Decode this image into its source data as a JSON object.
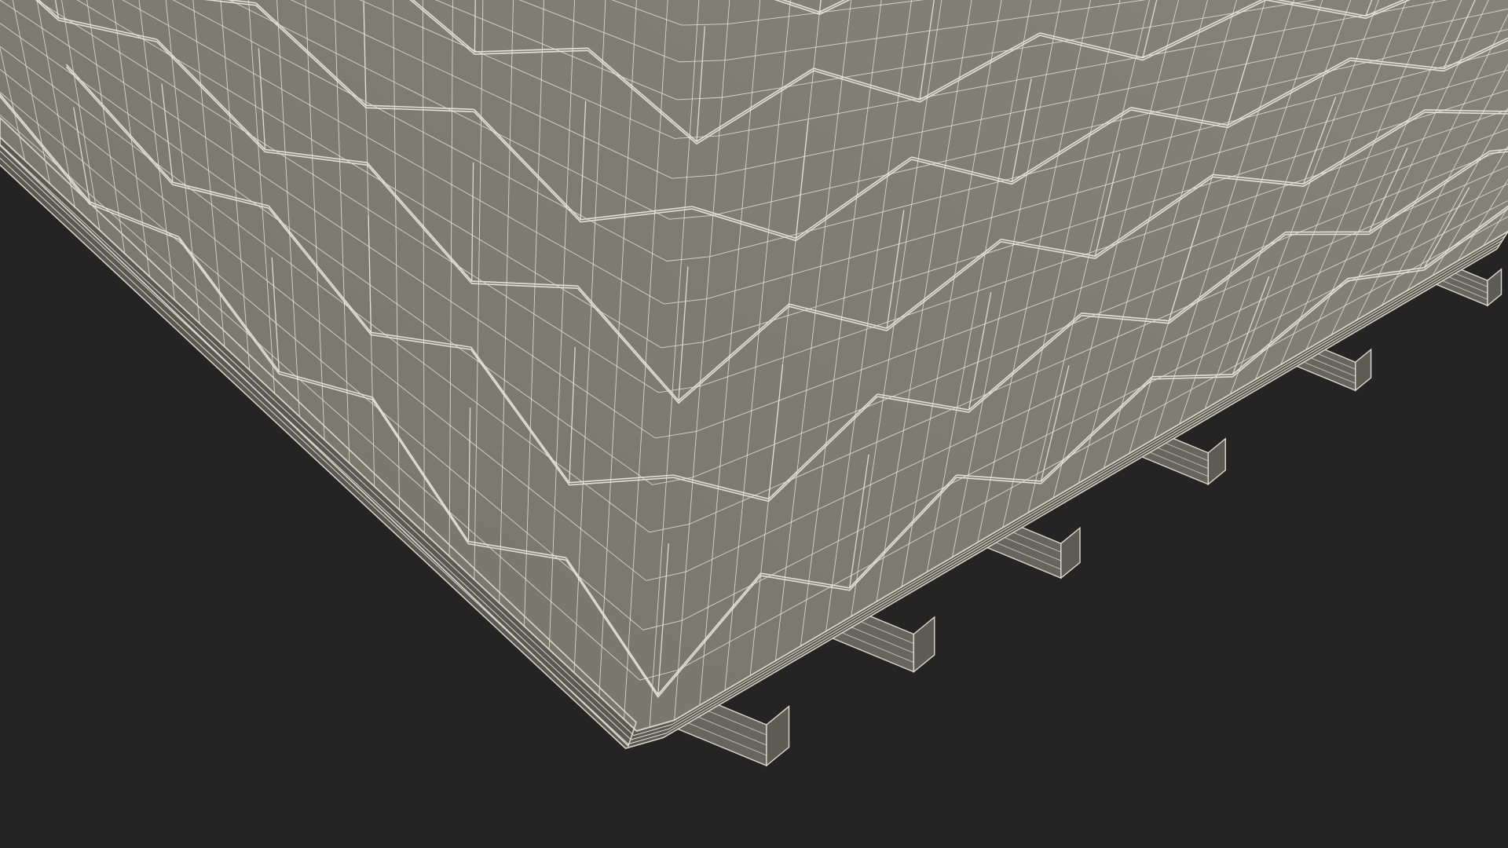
{
  "scene": {
    "subject": "wireframe-roof-panel",
    "colors": {
      "background": "#242424",
      "panel_fill": "#74746a",
      "panel_fill_far": "#8a8a80",
      "wire": "#e6e6da",
      "edge": "#d9d9cc",
      "beam_fill": "#66665e"
    },
    "beam_count": 6,
    "visible_text": []
  }
}
